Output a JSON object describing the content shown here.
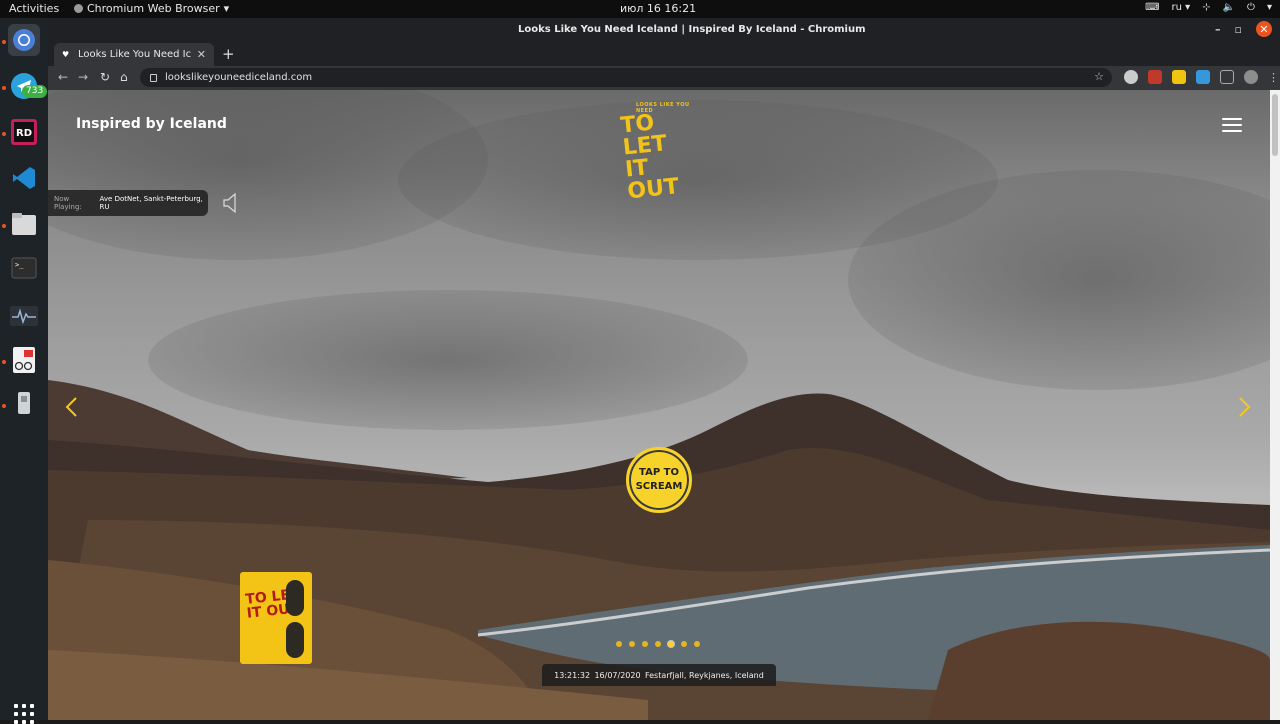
{
  "topbar": {
    "activities": "Activities",
    "app_menu": "Chromium Web Browser",
    "clock": "июл 16  16:21",
    "lang": "ru"
  },
  "dock": {
    "telegram_badge": "733",
    "items": [
      "chromium-icon",
      "telegram-icon",
      "rider-icon",
      "vscode-icon",
      "files-icon",
      "terminal-icon",
      "system-monitor-icon",
      "document-viewer-icon",
      "usb-drive-icon"
    ]
  },
  "window": {
    "title": "Looks Like You Need Iceland | Inspired By Iceland - Chromium"
  },
  "tabs": [
    {
      "label": "Looks Like You Need Ic"
    }
  ],
  "omnibox": {
    "url": "lookslikeyouneediceland.com"
  },
  "page": {
    "brand": "Inspired by Iceland",
    "logo_small": "LOOKS LIKE YOU NEED",
    "logo_big": "TO LET IT OUT",
    "now_playing_label": "Now Playing:",
    "now_playing_track": "Ave DotNet, Sankt-Peterburg, RU",
    "scream_line1": "TAP TO",
    "scream_line2": "SCREAM",
    "slides_total": 7,
    "slide_active": 5,
    "info_time": "13:21:32",
    "info_date": "16/07/2020",
    "info_location": "Festarfjall, Reykjanes, Iceland"
  },
  "colors": {
    "accent_yellow": "#f7d22b",
    "ubuntu_orange": "#e95420"
  }
}
